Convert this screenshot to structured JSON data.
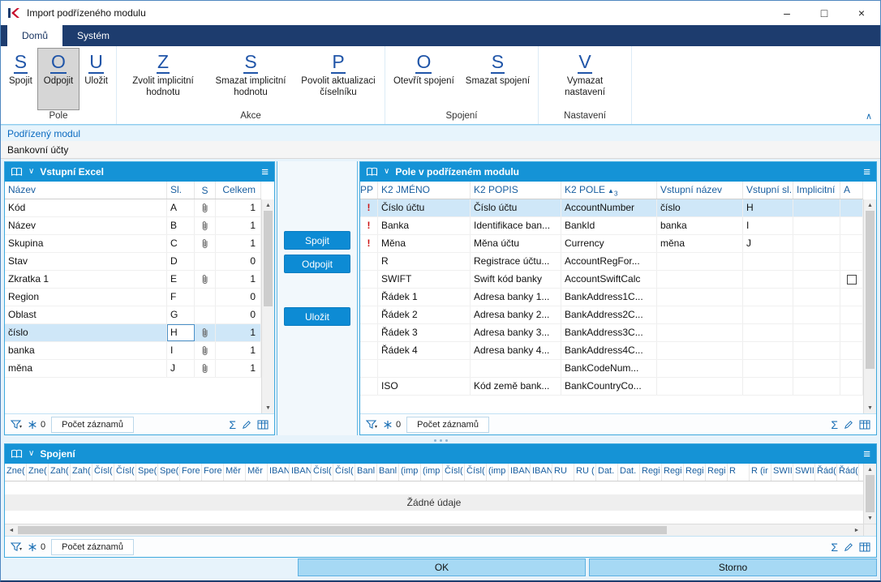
{
  "window": {
    "title": "Import podřízeného modulu",
    "minimize": "–",
    "maximize": "□",
    "close": "×"
  },
  "tabs": [
    {
      "label": "Domů",
      "active": true
    },
    {
      "label": "Systém",
      "active": false
    }
  ],
  "ribbon": {
    "groups": [
      {
        "label": "Pole",
        "buttons": [
          {
            "letter": "S",
            "label": "Spojit",
            "pressed": false
          },
          {
            "letter": "O",
            "label": "Odpojit",
            "pressed": true
          },
          {
            "letter": "U",
            "label": "Uložit",
            "pressed": false
          }
        ]
      },
      {
        "label": "Akce",
        "buttons": [
          {
            "letter": "Z",
            "label": "Zvolit implicitní hodnotu",
            "pressed": false
          },
          {
            "letter": "S",
            "label": "Smazat implicitní hodnotu",
            "pressed": false
          },
          {
            "letter": "P",
            "label": "Povolit aktualizaci číselníku",
            "pressed": false
          }
        ]
      },
      {
        "label": "Spojení",
        "buttons": [
          {
            "letter": "O",
            "label": "Otevřít spojení",
            "pressed": false
          },
          {
            "letter": "S",
            "label": "Smazat spojení",
            "pressed": false
          }
        ]
      },
      {
        "label": "Nastavení",
        "buttons": [
          {
            "letter": "V",
            "label": "Vymazat nastavení",
            "pressed": false
          }
        ]
      }
    ]
  },
  "infobar": {
    "label": "Podřízený modul",
    "value": "Bankovní účty"
  },
  "left_panel": {
    "title": "Vstupní Excel",
    "columns": [
      "Název",
      "Sl.",
      "S",
      "Celkem"
    ],
    "rows": [
      {
        "name": "Kód",
        "col": "A",
        "clip": true,
        "total": "1"
      },
      {
        "name": "Název",
        "col": "B",
        "clip": true,
        "total": "1"
      },
      {
        "name": "Skupina",
        "col": "C",
        "clip": true,
        "total": "1"
      },
      {
        "name": "Stav",
        "col": "D",
        "clip": false,
        "total": "0"
      },
      {
        "name": "Zkratka 1",
        "col": "E",
        "clip": true,
        "total": "1"
      },
      {
        "name": "Region",
        "col": "F",
        "clip": false,
        "total": "0"
      },
      {
        "name": "Oblast",
        "col": "G",
        "clip": false,
        "total": "0"
      },
      {
        "name": "číslo",
        "col": "H",
        "clip": true,
        "total": "1",
        "selected": true
      },
      {
        "name": "banka",
        "col": "I",
        "clip": true,
        "total": "1"
      },
      {
        "name": "měna",
        "col": "J",
        "clip": true,
        "total": "1"
      }
    ],
    "status": {
      "badge_count": "0",
      "records_label": "Počet záznamů"
    }
  },
  "middle_buttons": [
    {
      "label": "Spojit"
    },
    {
      "label": "Odpojit"
    },
    {
      "label": "Uložit"
    }
  ],
  "right_panel": {
    "title": "Pole v podřízeném modulu",
    "columns": [
      "PP",
      "K2 JMÉNO",
      "K2 POPIS",
      "K2 POLE",
      "Vstupní název",
      "Vstupní sl.",
      "Implicitní",
      "A"
    ],
    "sort": {
      "column": "K2 POLE",
      "indicator": "▲",
      "order": "3"
    },
    "rows": [
      {
        "pp": "!",
        "k2name": "Číslo účtu",
        "k2desc": "Číslo účtu",
        "k2field": "AccountNumber",
        "input_name": "číslo",
        "input_col": "H",
        "selected": true
      },
      {
        "pp": "!",
        "k2name": "Banka",
        "k2desc": "Identifikace ban...",
        "k2field": "BankId",
        "input_name": "banka",
        "input_col": "I"
      },
      {
        "pp": "!",
        "k2name": "Měna",
        "k2desc": "Měna účtu",
        "k2field": "Currency",
        "input_name": "měna",
        "input_col": "J"
      },
      {
        "pp": "",
        "k2name": "R",
        "k2desc": "Registrace účtu...",
        "k2field": "AccountRegFor...",
        "input_name": "",
        "input_col": ""
      },
      {
        "pp": "",
        "k2name": "SWIFT",
        "k2desc": "Swift kód banky",
        "k2field": "AccountSwiftCalc",
        "input_name": "",
        "input_col": "",
        "checkbox": true
      },
      {
        "pp": "",
        "k2name": "Řádek 1",
        "k2desc": "Adresa banky 1...",
        "k2field": "BankAddress1C...",
        "input_name": "",
        "input_col": ""
      },
      {
        "pp": "",
        "k2name": "Řádek 2",
        "k2desc": "Adresa banky 2...",
        "k2field": "BankAddress2C...",
        "input_name": "",
        "input_col": ""
      },
      {
        "pp": "",
        "k2name": "Řádek 3",
        "k2desc": "Adresa banky 3...",
        "k2field": "BankAddress3C...",
        "input_name": "",
        "input_col": ""
      },
      {
        "pp": "",
        "k2name": "Řádek 4",
        "k2desc": "Adresa banky 4...",
        "k2field": "BankAddress4C...",
        "input_name": "",
        "input_col": ""
      },
      {
        "pp": "",
        "k2name": "",
        "k2desc": "",
        "k2field": "BankCodeNum...",
        "input_name": "",
        "input_col": ""
      },
      {
        "pp": "",
        "k2name": "ISO",
        "k2desc": "Kód země bank...",
        "k2field": "BankCountryCo...",
        "input_name": "",
        "input_col": ""
      }
    ],
    "status": {
      "badge_count": "0",
      "records_label": "Počet záznamů"
    }
  },
  "bottom_panel": {
    "title": "Spojení",
    "columns": [
      "Zne(",
      "Zne(",
      "Zah(",
      "Zah(",
      "Čísl(",
      "Čísl(",
      "Spe(",
      "Spe(",
      "Fore",
      "Fore",
      "Měr",
      "Měr",
      "IBAN",
      "IBAN",
      "Čísl(",
      "Čísl(",
      "Banl",
      "Banl",
      "(imp",
      "(imp",
      "Čísl(",
      "Čísl(",
      "(imp",
      "IBAN",
      "IBAN",
      "RU",
      "RU (",
      "Dat.",
      "Dat.",
      "Regi",
      "Regi",
      "Regi",
      "Regi",
      "R",
      "R (ir",
      "SWII",
      "SWII",
      "Řád(",
      "Řád("
    ],
    "empty_text": "Žádné údaje",
    "status": {
      "badge_count": "0",
      "records_label": "Počet záznamů"
    }
  },
  "footer": {
    "ok": "OK",
    "cancel": "Storno"
  },
  "icons": {
    "chevron_down": "∨",
    "menu": "≡",
    "collapse": "∧",
    "sum": "Σ",
    "scroll_up": "▲",
    "scroll_down": "▼",
    "scroll_left": "◄",
    "scroll_right": "►"
  },
  "colors": {
    "accent_blue": "#1593d6",
    "ribbon_navy": "#1d3c6e",
    "selection": "#cfe7f8",
    "alert_red": "#cc1111",
    "header_text_blue": "#1a5fa0",
    "footer_button": "#a6d9f4"
  }
}
